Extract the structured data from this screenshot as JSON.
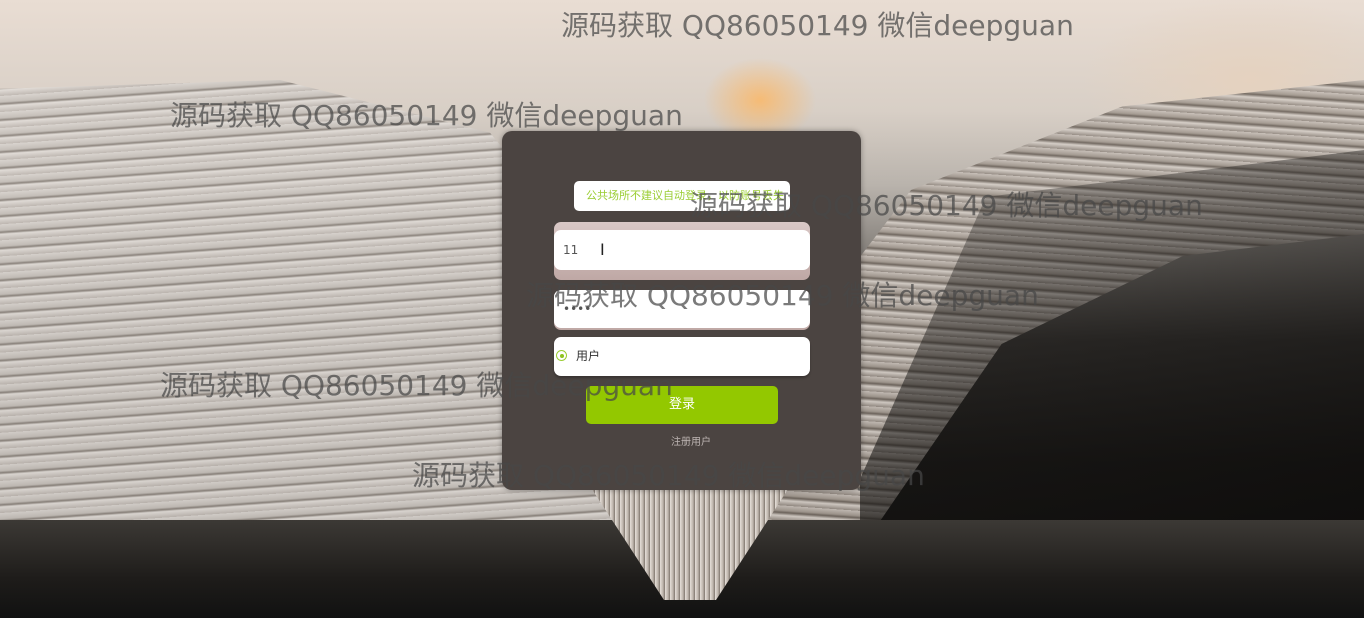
{
  "background": {
    "scene": "open-book-photo"
  },
  "login": {
    "hint": "公共场所不建议自动登录，以防账号丢失",
    "username_value": "11",
    "password_mask": "••••",
    "role_label": "用户",
    "login_label": "登录",
    "register_label": "注册用户"
  },
  "colors": {
    "accent_green": "#93c800",
    "hint_text": "#9acd32",
    "panel_bg": "#4b4441"
  },
  "icons": {
    "text_cursor": "I-beam"
  },
  "watermarks": [
    "源码获取 QQ86050149 微信deepguan",
    "源码获取 QQ86050149 微信deepguan",
    "源码获取 QQ86050149 微信deepguan",
    "源码获取 QQ86050149 微信deepguan",
    "源码获取 QQ86050149 微信deepguan",
    "源码获取 QQ86050149 微信deepguan"
  ]
}
